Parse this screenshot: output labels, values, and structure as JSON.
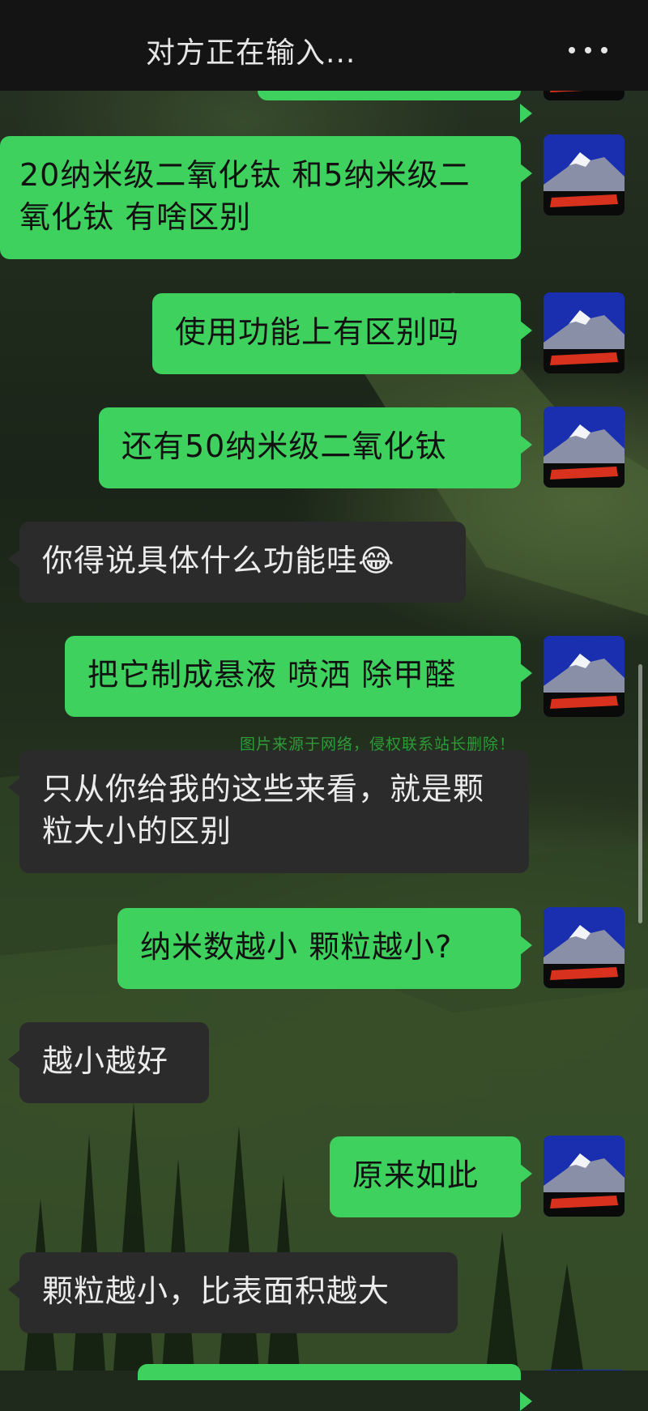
{
  "header": {
    "title": "对方正在输入...",
    "more_icon": "more-dots-icon"
  },
  "watermark": "图片来源于网络，侵权联系站长删除！",
  "colors": {
    "sent_bubble": "#3fd15e",
    "recv_bubble": "#2b2b2b",
    "header_bg": "#141414"
  },
  "messages": [
    {
      "side": "sent",
      "text": "20纳米级二氧化钛 和5纳米级二氧化钛 有啥区别"
    },
    {
      "side": "sent",
      "text": "使用功能上有区别吗"
    },
    {
      "side": "sent",
      "text": "还有50纳米级二氧化钛"
    },
    {
      "side": "recv",
      "text": "你得说具体什么功能哇😂"
    },
    {
      "side": "sent",
      "text": "把它制成悬液 喷洒 除甲醛"
    },
    {
      "side": "recv",
      "text": "只从你给我的这些来看，就是颗粒大小的区别"
    },
    {
      "side": "sent",
      "text": "纳米数越小 颗粒越小?"
    },
    {
      "side": "recv",
      "text": "越小越好"
    },
    {
      "side": "sent",
      "text": "原来如此"
    },
    {
      "side": "recv",
      "text": "颗粒越小，比表面积越大"
    }
  ]
}
